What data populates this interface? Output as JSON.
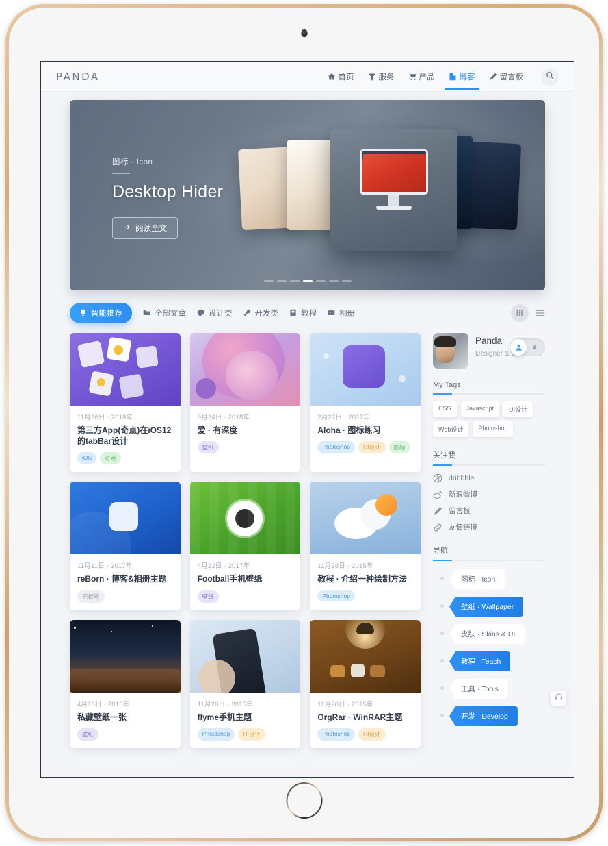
{
  "site": {
    "logo": "PANDA"
  },
  "nav": {
    "items": [
      {
        "label": "首页",
        "icon": "home-icon",
        "active": false
      },
      {
        "label": "服务",
        "icon": "filter-icon",
        "active": false
      },
      {
        "label": "产品",
        "icon": "cart-icon",
        "active": false
      },
      {
        "label": "博客",
        "icon": "blog-icon",
        "active": true
      },
      {
        "label": "留言板",
        "icon": "pen-icon",
        "active": false
      }
    ],
    "search_icon": "search-icon"
  },
  "hero": {
    "category": "图标 · Icon",
    "title": "Desktop Hider",
    "button": "阅读全文",
    "button_icon": "arrow-right-icon",
    "slides": 7,
    "active_slide": 4
  },
  "filters": {
    "items": [
      {
        "label": "智能推荐",
        "icon": "bulb-icon",
        "active": true
      },
      {
        "label": "全部文章",
        "icon": "folder-icon",
        "active": false
      },
      {
        "label": "设计类",
        "icon": "palette-icon",
        "active": false
      },
      {
        "label": "开发类",
        "icon": "wrench-icon",
        "active": false
      },
      {
        "label": "教程",
        "icon": "book-icon",
        "active": false
      },
      {
        "label": "相册",
        "icon": "album-icon",
        "active": false
      }
    ],
    "grid_icon": "grid-view-icon",
    "list_icon": "list-view-icon"
  },
  "cards": [
    {
      "date": "11月26日 · 2018年",
      "title": "第三方App(奇点)在iOS12的tabBar设计",
      "tags": [
        {
          "label": "iOS",
          "color": "t-blue"
        },
        {
          "label": "奇点",
          "color": "t-green"
        }
      ],
      "art": "a1"
    },
    {
      "date": "9月24日 · 2018年",
      "title": "爱 · 有深度",
      "tags": [
        {
          "label": "壁纸",
          "color": "t-purple"
        }
      ],
      "art": "a2"
    },
    {
      "date": "2月27日 · 2017年",
      "title": "Aloha · 图标练习",
      "tags": [
        {
          "label": "Photoshop",
          "color": "t-blue"
        },
        {
          "label": "UI设计",
          "color": "t-orange"
        },
        {
          "label": "图标",
          "color": "t-green"
        }
      ],
      "art": "a3"
    },
    {
      "date": "11月11日 · 2017年",
      "title": "reBorn · 博客&相册主题",
      "tags": [
        {
          "label": "无标签",
          "color": "t-gray"
        }
      ],
      "art": "a4"
    },
    {
      "date": "4月22日 · 2017年",
      "title": "Football手机壁纸",
      "tags": [
        {
          "label": "壁纸",
          "color": "t-purple"
        }
      ],
      "art": "a5"
    },
    {
      "date": "11月28日 · 2015年",
      "title": "教程 · 介绍一种绘制方法",
      "tags": [
        {
          "label": "Photoshop",
          "color": "t-blue"
        }
      ],
      "art": "a6"
    },
    {
      "date": "4月16日 · 2016年",
      "title": "私藏壁纸一张",
      "tags": [
        {
          "label": "壁纸",
          "color": "t-purple"
        }
      ],
      "art": "a7"
    },
    {
      "date": "11月20日 · 2015年",
      "title": "flyme手机主题",
      "tags": [
        {
          "label": "Photoshop",
          "color": "t-blue"
        },
        {
          "label": "UI设计",
          "color": "t-orange"
        }
      ],
      "art": "a8"
    },
    {
      "date": "11月20日 · 2015年",
      "title": "OrgRar · WinRAR主题",
      "tags": [
        {
          "label": "Photoshop",
          "color": "t-blue"
        },
        {
          "label": "UI设计",
          "color": "t-orange"
        }
      ],
      "art": "a9"
    }
  ],
  "sidebar": {
    "profile": {
      "name": "Panda",
      "role": "Designer & Developer"
    },
    "tags_section": {
      "title": "My Tags",
      "tags": [
        "CSS",
        "Javascript",
        "UI设计",
        "Web设计",
        "Photoshop"
      ]
    },
    "follow_section": {
      "title": "关注我",
      "links": [
        {
          "label": "dribbble",
          "icon": "dribbble-icon"
        },
        {
          "label": "新浪微博",
          "icon": "weibo-icon"
        },
        {
          "label": "留言板",
          "icon": "pen-icon"
        },
        {
          "label": "友情链接",
          "icon": "link-icon"
        }
      ]
    },
    "nav_section": {
      "title": "导航",
      "items": [
        {
          "label": "图标 · Icon",
          "active": false
        },
        {
          "label": "壁纸 · Wallpaper",
          "active": true
        },
        {
          "label": "皮肤 · Skins & UI",
          "active": false
        },
        {
          "label": "教程 · Teach",
          "active": true
        },
        {
          "label": "工具 · Tools",
          "active": false
        },
        {
          "label": "开发 · Develop",
          "active": true
        }
      ]
    }
  },
  "widgets": {
    "account_toggle": {
      "on_icon": "user-icon",
      "off_icon": "flame-icon"
    },
    "music_button": {
      "icon": "headphones-icon"
    }
  },
  "colors": {
    "accent": "#2f90f2",
    "text": "#39434f",
    "muted": "#9aa3b0",
    "bg": "#f3f5f8"
  }
}
